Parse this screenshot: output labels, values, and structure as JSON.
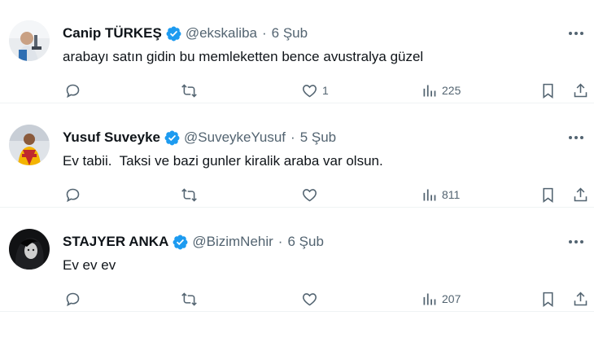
{
  "tweets": [
    {
      "name": "Canip TÜRKEŞ",
      "handle": "@ekskaliba",
      "separator": "·",
      "date": "6 Şub",
      "text": "arabayı satın gidin bu memleketten bence avustralya güzel",
      "likes": "1",
      "views": "225",
      "avatar_icon": "person-with-microscope-avatar"
    },
    {
      "name": "Yusuf Suveyke",
      "handle": "@SuveykeYusuf",
      "separator": "·",
      "date": "5 Şub",
      "text": "Ev tabii.  Taksi ve bazi gunler kiralik araba var olsun.",
      "likes": "",
      "views": "811",
      "avatar_icon": "person-in-jersey-avatar"
    },
    {
      "name": "STAJYER ANKA",
      "handle": "@BizimNehir",
      "separator": "·",
      "date": "6 Şub",
      "text": "Ev ev ev",
      "likes": "",
      "views": "207",
      "avatar_icon": "dark-portrait-avatar"
    }
  ],
  "colors": {
    "verified": "#1d9bf0",
    "muted": "#536471",
    "text": "#0f1419",
    "divider": "#eff3f4"
  }
}
